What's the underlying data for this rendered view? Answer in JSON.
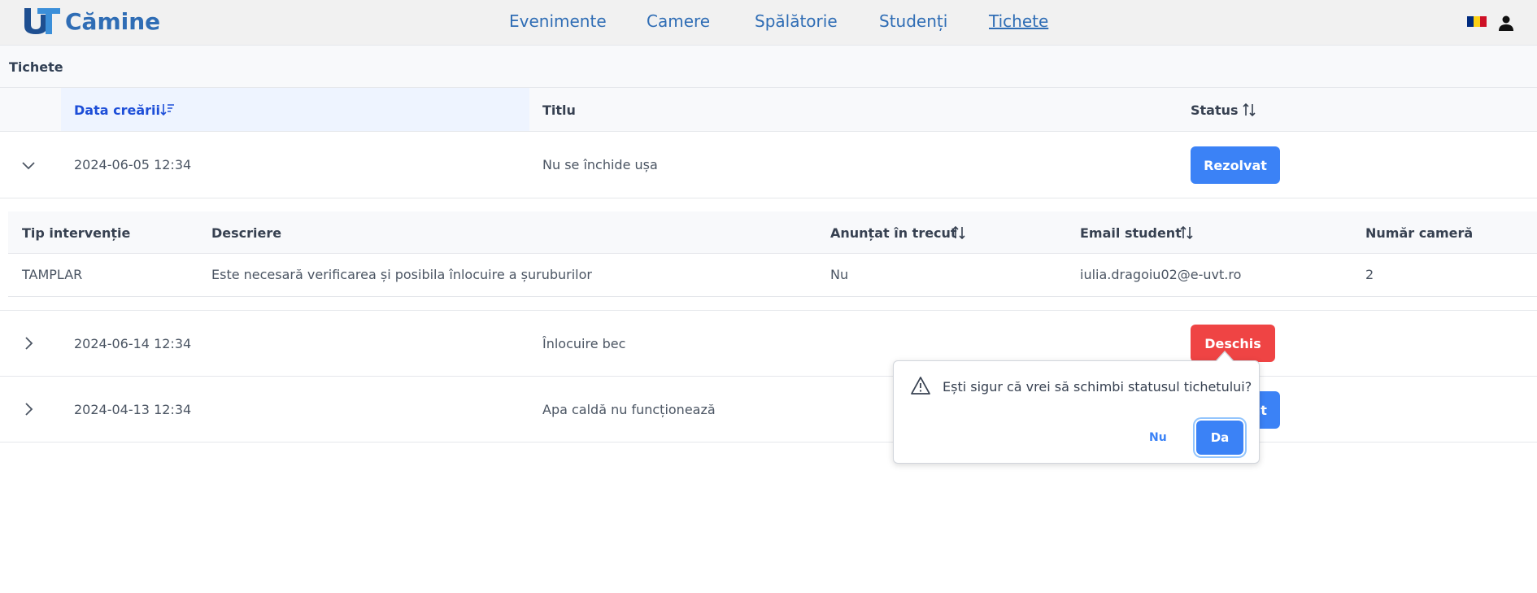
{
  "app": {
    "brand": "Cămine"
  },
  "nav": [
    {
      "label": "Evenimente"
    },
    {
      "label": "Camere"
    },
    {
      "label": "Spălătorie"
    },
    {
      "label": "Studenți"
    },
    {
      "label": "Tichete",
      "active": true
    }
  ],
  "panel": {
    "title": "Tichete"
  },
  "table": {
    "columns": {
      "date": "Data creării",
      "title": "Titlu",
      "status": "Status"
    },
    "rows": [
      {
        "date": "2024-06-05 12:34",
        "title": "Nu se închide ușa",
        "status": "Rezolvat",
        "expanded": true
      },
      {
        "date": "2024-06-14 12:34",
        "title": "Înlocuire bec",
        "status": "Deschis",
        "expanded": false
      },
      {
        "date": "2024-04-13 12:34",
        "title": "Apa caldă nu funcționează",
        "status": "Rezolvat",
        "expanded": false
      }
    ]
  },
  "details": {
    "columns": {
      "type": "Tip intervenție",
      "description": "Descriere",
      "announced": "Anunțat în trecut",
      "email": "Email student",
      "room": "Număr cameră"
    },
    "row": {
      "type": "TAMPLAR",
      "description": "Este necesară verificarea și posibila înlocuire a șuruburilor",
      "announced": "Nu",
      "email": "iulia.dragoiu02@e-uvt.ro",
      "room": "2"
    }
  },
  "confirm": {
    "message": "Ești sigur că vrei să schimbi statusul tichetului?",
    "no": "Nu",
    "yes": "Da"
  },
  "colors": {
    "primary": "#3b82f6",
    "danger": "#ef4444",
    "brand": "#2f6db5"
  },
  "icons": [
    "uvt-logo-icon",
    "romania-flag-icon",
    "user-icon",
    "sort-desc-icon",
    "sort-icon",
    "chevron-down-icon",
    "chevron-right-icon",
    "warning-icon"
  ]
}
